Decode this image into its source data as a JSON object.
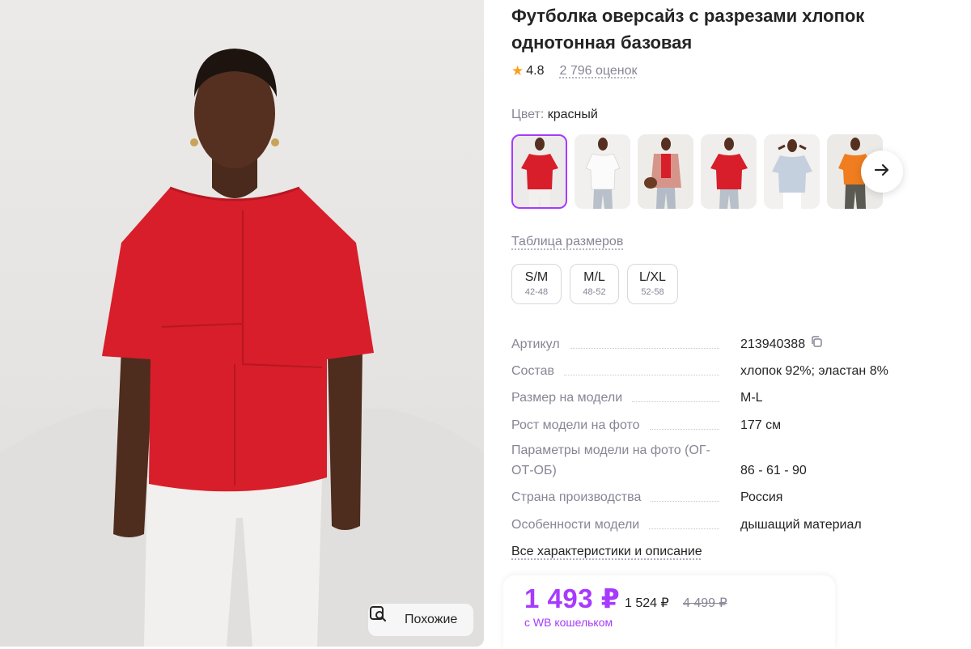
{
  "photo": {
    "similar_label": "Похожие",
    "similar_icon": "search-similar-icon"
  },
  "product": {
    "title": "Футболка оверсайз с разрезами хлопок однотонная базовая",
    "rating": "4.8",
    "reviews": "2 796 оценок"
  },
  "color": {
    "label": "Цвет:",
    "value": "красный",
    "thumbnails": [
      "red-tee",
      "white-tee",
      "pink-jacket",
      "red-tee-2",
      "grey-tee",
      "orange-tee"
    ]
  },
  "sizes": {
    "table_link": "Таблица размеров",
    "items": [
      {
        "name": "S/M",
        "range": "42-48"
      },
      {
        "name": "M/L",
        "range": "48-52"
      },
      {
        "name": "L/XL",
        "range": "52-58"
      }
    ]
  },
  "specs": [
    {
      "key": "Артикул",
      "value": "213940388"
    },
    {
      "key": "Состав",
      "value": "хлопок 92%; эластан 8%"
    },
    {
      "key": "Размер на модели",
      "value": "M-L"
    },
    {
      "key": "Рост модели на фото",
      "value": "177 см"
    },
    {
      "key": "Параметры модели на фото (ОГ-ОТ-ОБ)",
      "value": "86 - 61 - 90"
    },
    {
      "key": "Страна производства",
      "value": "Россия"
    },
    {
      "key": "Особенности модели",
      "value": "дышащий материал"
    }
  ],
  "all_characteristics": "Все характеристики и описание",
  "price": {
    "current": "1 493 ₽",
    "old": "1 524 ₽",
    "crossed": "4 499 ₽",
    "wallet_note": "с WB кошельком"
  },
  "colors": {
    "accent": "#a73afd",
    "star": "#ff9c1a",
    "shirt_red": "#d81e2a"
  }
}
